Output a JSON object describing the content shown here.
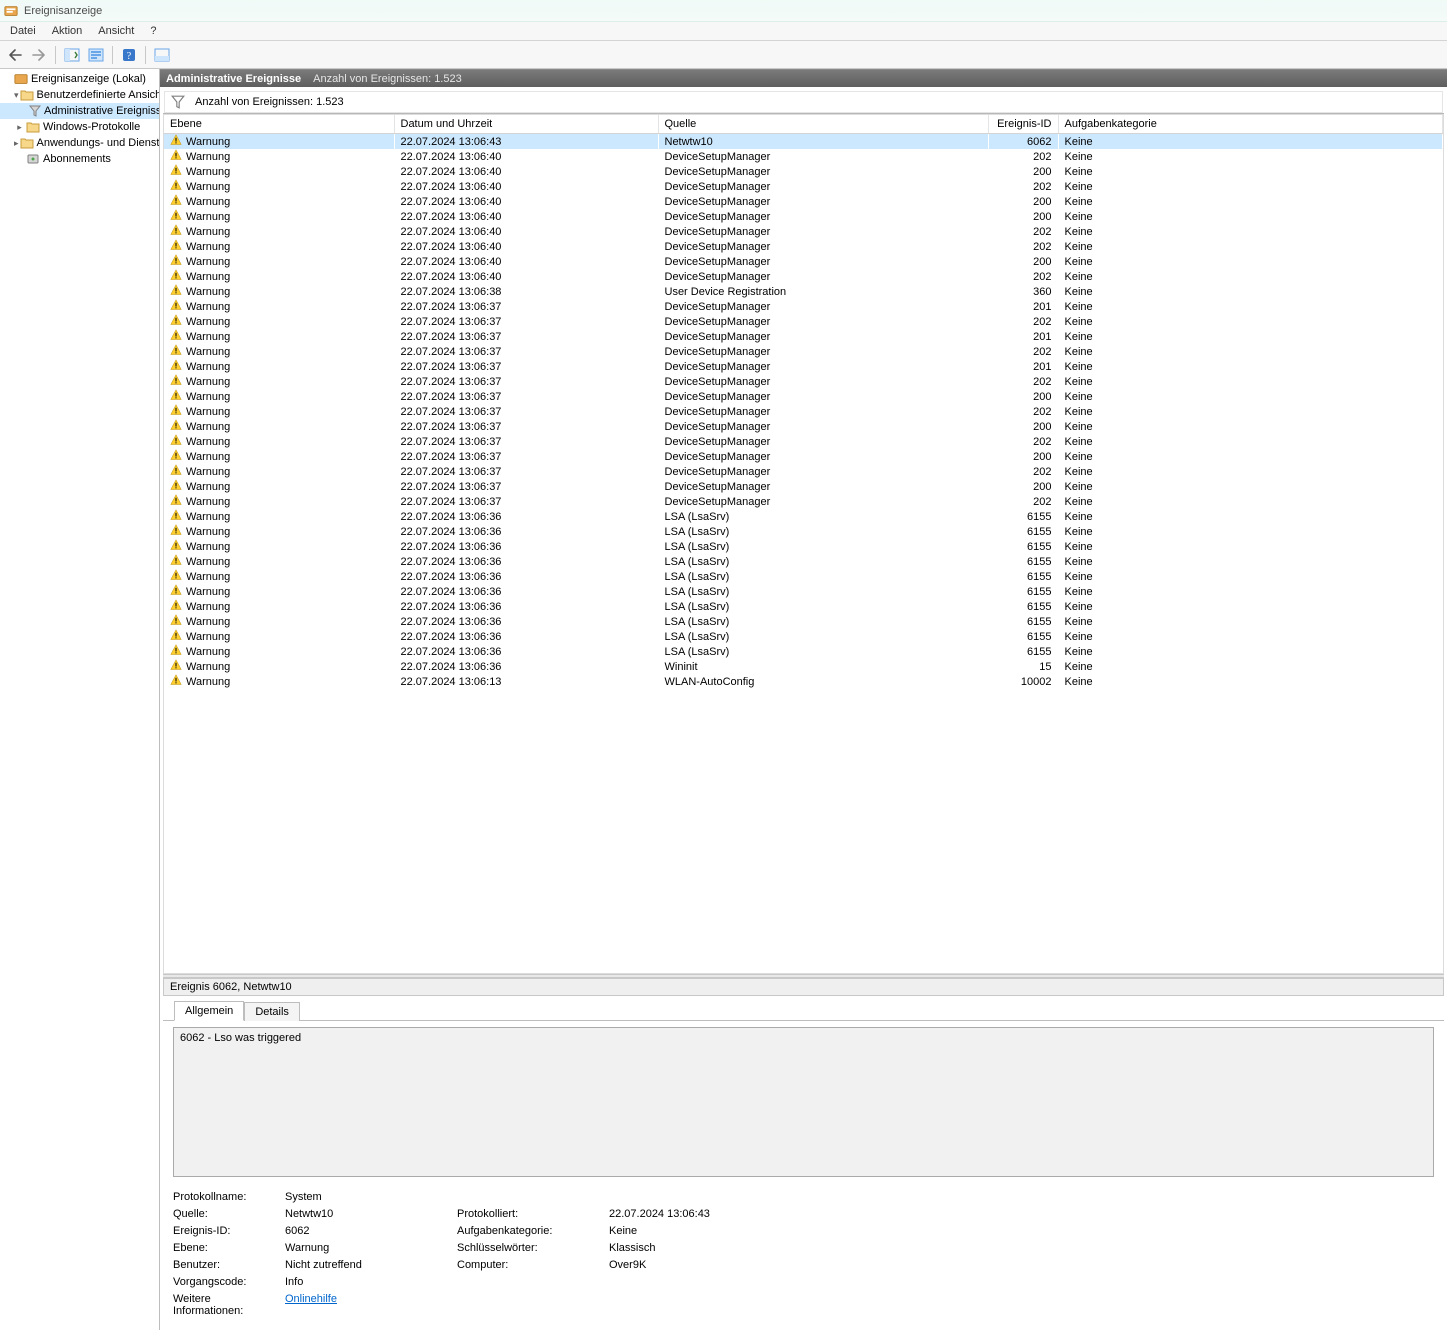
{
  "app": {
    "title": "Ereignisanzeige"
  },
  "menu": {
    "items": [
      "Datei",
      "Aktion",
      "Ansicht",
      "?"
    ]
  },
  "tree": {
    "root": "Ereignisanzeige (Lokal)",
    "custom_views": "Benutzerdefinierte Ansichten",
    "admin_events": "Administrative Ereignisse",
    "win_logs": "Windows-Protokolle",
    "app_logs": "Anwendungs- und Dienstprotokolle",
    "subs": "Abonnements"
  },
  "panel": {
    "title": "Administrative Ereignisse",
    "count_label": "Anzahl von Ereignissen:",
    "count": "1.523"
  },
  "filter": {
    "count_label": "Anzahl von Ereignissen:",
    "count": "1.523"
  },
  "columns": {
    "level": "Ebene",
    "dt": "Datum und Uhrzeit",
    "src": "Quelle",
    "id": "Ereignis-ID",
    "cat": "Aufgabenkategorie"
  },
  "events": [
    {
      "level": "Warnung",
      "dt": "22.07.2024 13:06:43",
      "src": "Netwtw10",
      "id": "6062",
      "cat": "Keine",
      "sel": true
    },
    {
      "level": "Warnung",
      "dt": "22.07.2024 13:06:40",
      "src": "DeviceSetupManager",
      "id": "202",
      "cat": "Keine"
    },
    {
      "level": "Warnung",
      "dt": "22.07.2024 13:06:40",
      "src": "DeviceSetupManager",
      "id": "200",
      "cat": "Keine"
    },
    {
      "level": "Warnung",
      "dt": "22.07.2024 13:06:40",
      "src": "DeviceSetupManager",
      "id": "202",
      "cat": "Keine"
    },
    {
      "level": "Warnung",
      "dt": "22.07.2024 13:06:40",
      "src": "DeviceSetupManager",
      "id": "200",
      "cat": "Keine"
    },
    {
      "level": "Warnung",
      "dt": "22.07.2024 13:06:40",
      "src": "DeviceSetupManager",
      "id": "200",
      "cat": "Keine"
    },
    {
      "level": "Warnung",
      "dt": "22.07.2024 13:06:40",
      "src": "DeviceSetupManager",
      "id": "202",
      "cat": "Keine"
    },
    {
      "level": "Warnung",
      "dt": "22.07.2024 13:06:40",
      "src": "DeviceSetupManager",
      "id": "202",
      "cat": "Keine"
    },
    {
      "level": "Warnung",
      "dt": "22.07.2024 13:06:40",
      "src": "DeviceSetupManager",
      "id": "200",
      "cat": "Keine"
    },
    {
      "level": "Warnung",
      "dt": "22.07.2024 13:06:40",
      "src": "DeviceSetupManager",
      "id": "202",
      "cat": "Keine"
    },
    {
      "level": "Warnung",
      "dt": "22.07.2024 13:06:38",
      "src": "User Device Registration",
      "id": "360",
      "cat": "Keine"
    },
    {
      "level": "Warnung",
      "dt": "22.07.2024 13:06:37",
      "src": "DeviceSetupManager",
      "id": "201",
      "cat": "Keine"
    },
    {
      "level": "Warnung",
      "dt": "22.07.2024 13:06:37",
      "src": "DeviceSetupManager",
      "id": "202",
      "cat": "Keine"
    },
    {
      "level": "Warnung",
      "dt": "22.07.2024 13:06:37",
      "src": "DeviceSetupManager",
      "id": "201",
      "cat": "Keine"
    },
    {
      "level": "Warnung",
      "dt": "22.07.2024 13:06:37",
      "src": "DeviceSetupManager",
      "id": "202",
      "cat": "Keine"
    },
    {
      "level": "Warnung",
      "dt": "22.07.2024 13:06:37",
      "src": "DeviceSetupManager",
      "id": "201",
      "cat": "Keine"
    },
    {
      "level": "Warnung",
      "dt": "22.07.2024 13:06:37",
      "src": "DeviceSetupManager",
      "id": "202",
      "cat": "Keine"
    },
    {
      "level": "Warnung",
      "dt": "22.07.2024 13:06:37",
      "src": "DeviceSetupManager",
      "id": "200",
      "cat": "Keine"
    },
    {
      "level": "Warnung",
      "dt": "22.07.2024 13:06:37",
      "src": "DeviceSetupManager",
      "id": "202",
      "cat": "Keine"
    },
    {
      "level": "Warnung",
      "dt": "22.07.2024 13:06:37",
      "src": "DeviceSetupManager",
      "id": "200",
      "cat": "Keine"
    },
    {
      "level": "Warnung",
      "dt": "22.07.2024 13:06:37",
      "src": "DeviceSetupManager",
      "id": "202",
      "cat": "Keine"
    },
    {
      "level": "Warnung",
      "dt": "22.07.2024 13:06:37",
      "src": "DeviceSetupManager",
      "id": "200",
      "cat": "Keine"
    },
    {
      "level": "Warnung",
      "dt": "22.07.2024 13:06:37",
      "src": "DeviceSetupManager",
      "id": "202",
      "cat": "Keine"
    },
    {
      "level": "Warnung",
      "dt": "22.07.2024 13:06:37",
      "src": "DeviceSetupManager",
      "id": "200",
      "cat": "Keine"
    },
    {
      "level": "Warnung",
      "dt": "22.07.2024 13:06:37",
      "src": "DeviceSetupManager",
      "id": "202",
      "cat": "Keine"
    },
    {
      "level": "Warnung",
      "dt": "22.07.2024 13:06:36",
      "src": "LSA (LsaSrv)",
      "id": "6155",
      "cat": "Keine"
    },
    {
      "level": "Warnung",
      "dt": "22.07.2024 13:06:36",
      "src": "LSA (LsaSrv)",
      "id": "6155",
      "cat": "Keine"
    },
    {
      "level": "Warnung",
      "dt": "22.07.2024 13:06:36",
      "src": "LSA (LsaSrv)",
      "id": "6155",
      "cat": "Keine"
    },
    {
      "level": "Warnung",
      "dt": "22.07.2024 13:06:36",
      "src": "LSA (LsaSrv)",
      "id": "6155",
      "cat": "Keine"
    },
    {
      "level": "Warnung",
      "dt": "22.07.2024 13:06:36",
      "src": "LSA (LsaSrv)",
      "id": "6155",
      "cat": "Keine"
    },
    {
      "level": "Warnung",
      "dt": "22.07.2024 13:06:36",
      "src": "LSA (LsaSrv)",
      "id": "6155",
      "cat": "Keine"
    },
    {
      "level": "Warnung",
      "dt": "22.07.2024 13:06:36",
      "src": "LSA (LsaSrv)",
      "id": "6155",
      "cat": "Keine"
    },
    {
      "level": "Warnung",
      "dt": "22.07.2024 13:06:36",
      "src": "LSA (LsaSrv)",
      "id": "6155",
      "cat": "Keine"
    },
    {
      "level": "Warnung",
      "dt": "22.07.2024 13:06:36",
      "src": "LSA (LsaSrv)",
      "id": "6155",
      "cat": "Keine"
    },
    {
      "level": "Warnung",
      "dt": "22.07.2024 13:06:36",
      "src": "LSA (LsaSrv)",
      "id": "6155",
      "cat": "Keine"
    },
    {
      "level": "Warnung",
      "dt": "22.07.2024 13:06:36",
      "src": "Wininit",
      "id": "15",
      "cat": "Keine"
    },
    {
      "level": "Warnung",
      "dt": "22.07.2024 13:06:13",
      "src": "WLAN-AutoConfig",
      "id": "10002",
      "cat": "Keine"
    }
  ],
  "details": {
    "header": "Ereignis 6062, Netwtw10",
    "tabs": {
      "general": "Allgemein",
      "details": "Details"
    },
    "message": "6062 - Lso was triggered",
    "labels": {
      "logname": "Protokollname:",
      "source": "Quelle:",
      "logged": "Protokolliert:",
      "eventid": "Ereignis-ID:",
      "taskcat": "Aufgabenkategorie:",
      "level": "Ebene:",
      "keywords": "Schlüsselwörter:",
      "user": "Benutzer:",
      "computer": "Computer:",
      "opcode": "Vorgangscode:",
      "moreinfo": "Weitere Informationen:"
    },
    "values": {
      "logname": "System",
      "source": "Netwtw10",
      "logged": "22.07.2024 13:06:43",
      "eventid": "6062",
      "taskcat": "Keine",
      "level": "Warnung",
      "keywords": "Klassisch",
      "user": "Nicht zutreffend",
      "computer": "Over9K",
      "opcode": "Info",
      "moreinfo": "Onlinehilfe"
    }
  }
}
